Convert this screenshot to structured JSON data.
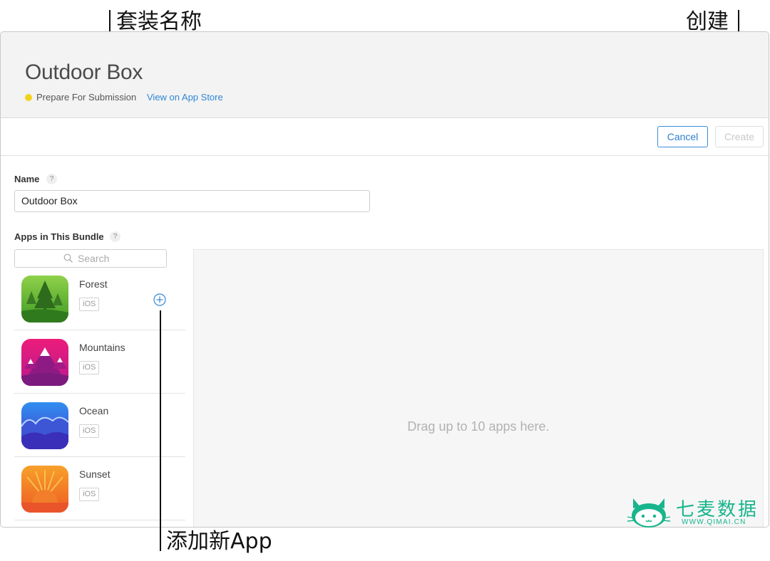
{
  "callouts": {
    "bundle_name": "套装名称",
    "create": "创建",
    "add_new_app": "添加新App"
  },
  "header": {
    "title": "Outdoor Box",
    "status": "Prepare For Submission",
    "status_color": "#f3d31a",
    "view_link": "View on App Store"
  },
  "toolbar": {
    "cancel_label": "Cancel",
    "create_label": "Create"
  },
  "form": {
    "name_label": "Name",
    "name_help": "?",
    "name_value": "Outdoor Box",
    "apps_label": "Apps in This Bundle",
    "apps_help": "?"
  },
  "search": {
    "placeholder": "Search",
    "icon": "search-icon"
  },
  "apps": [
    {
      "name": "Forest",
      "platform": "iOS",
      "icon": "forest-app-icon"
    },
    {
      "name": "Mountains",
      "platform": "iOS",
      "icon": "mountains-app-icon"
    },
    {
      "name": "Ocean",
      "platform": "iOS",
      "icon": "ocean-app-icon"
    },
    {
      "name": "Sunset",
      "platform": "iOS",
      "icon": "sunset-app-icon"
    }
  ],
  "drop_zone": {
    "text": "Drag up to 10 apps here."
  },
  "watermark": {
    "name": "七麦数据",
    "url": "WWW.QIMAI.CN",
    "color": "#18b58c"
  },
  "colors": {
    "accent": "#2f86d6",
    "disabled": "#c8c8c8"
  }
}
